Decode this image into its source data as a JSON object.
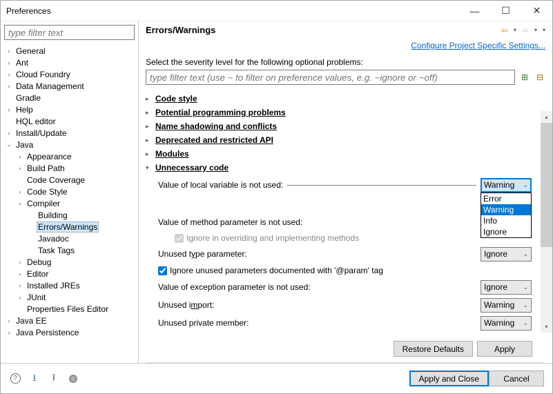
{
  "window": {
    "title": "Preferences"
  },
  "sidebar": {
    "filter_placeholder": "type filter text",
    "items": [
      {
        "label": "General",
        "depth": 0,
        "tw": "right"
      },
      {
        "label": "Ant",
        "depth": 0,
        "tw": "right"
      },
      {
        "label": "Cloud Foundry",
        "depth": 0,
        "tw": "right"
      },
      {
        "label": "Data Management",
        "depth": 0,
        "tw": "right"
      },
      {
        "label": "Gradle",
        "depth": 0,
        "tw": "none"
      },
      {
        "label": "Help",
        "depth": 0,
        "tw": "right"
      },
      {
        "label": "HQL editor",
        "depth": 0,
        "tw": "none"
      },
      {
        "label": "Install/Update",
        "depth": 0,
        "tw": "right"
      },
      {
        "label": "Java",
        "depth": 0,
        "tw": "down"
      },
      {
        "label": "Appearance",
        "depth": 1,
        "tw": "right"
      },
      {
        "label": "Build Path",
        "depth": 1,
        "tw": "right"
      },
      {
        "label": "Code Coverage",
        "depth": 1,
        "tw": "none"
      },
      {
        "label": "Code Style",
        "depth": 1,
        "tw": "right"
      },
      {
        "label": "Compiler",
        "depth": 1,
        "tw": "down"
      },
      {
        "label": "Building",
        "depth": 2,
        "tw": "none"
      },
      {
        "label": "Errors/Warnings",
        "depth": 2,
        "tw": "none",
        "selected": true
      },
      {
        "label": "Javadoc",
        "depth": 2,
        "tw": "none"
      },
      {
        "label": "Task Tags",
        "depth": 2,
        "tw": "none"
      },
      {
        "label": "Debug",
        "depth": 1,
        "tw": "right"
      },
      {
        "label": "Editor",
        "depth": 1,
        "tw": "right"
      },
      {
        "label": "Installed JREs",
        "depth": 1,
        "tw": "right"
      },
      {
        "label": "JUnit",
        "depth": 1,
        "tw": "right"
      },
      {
        "label": "Properties Files Editor",
        "depth": 1,
        "tw": "none"
      },
      {
        "label": "Java EE",
        "depth": 0,
        "tw": "right"
      },
      {
        "label": "Java Persistence",
        "depth": 0,
        "tw": "right"
      }
    ]
  },
  "main": {
    "heading": "Errors/Warnings",
    "config_link": "Configure Project Specific Settings...",
    "instruction": "Select the severity level for the following optional problems:",
    "search_placeholder": "type filter text (use ~ to filter on preference values, e.g. ~ignore or ~off)",
    "categories": [
      {
        "label": "Code style",
        "expanded": false
      },
      {
        "label": "Potential programming problems",
        "expanded": false
      },
      {
        "label": "Name shadowing and conflicts",
        "expanded": false,
        "accel": "m"
      },
      {
        "label": "Deprecated and restricted API",
        "expanded": false,
        "accel": "e"
      },
      {
        "label": "Modules",
        "expanded": false
      },
      {
        "label": "Unnecessary code",
        "expanded": true,
        "accel": "U"
      }
    ],
    "settings": {
      "local_var": {
        "label": "Value of local variable is not used:",
        "value": "Warning"
      },
      "method_param": {
        "label": "Value of method parameter is not used:",
        "sub": "Ignore in overriding and implementing methods"
      },
      "unused_type": {
        "label": "Unused type parameter:",
        "value": "Ignore",
        "accel": "y"
      },
      "ignore_param": {
        "label": "Ignore unused parameters documented with '@param' tag",
        "checked": true
      },
      "exception": {
        "label": "Value of exception parameter is not used:",
        "value": "Ignore"
      },
      "unused_import": {
        "label": "Unused import:",
        "value": "Warning",
        "accel": "m"
      },
      "unused_private": {
        "label": "Unused private member:",
        "value": "Warning"
      }
    },
    "dropdown_options": [
      "Error",
      "Warning",
      "Info",
      "Ignore"
    ],
    "dropdown_selected": "Warning",
    "buttons": {
      "restore": "Restore Defaults",
      "apply": "Apply"
    }
  },
  "footer": {
    "apply_close": "Apply and Close",
    "cancel": "Cancel"
  }
}
